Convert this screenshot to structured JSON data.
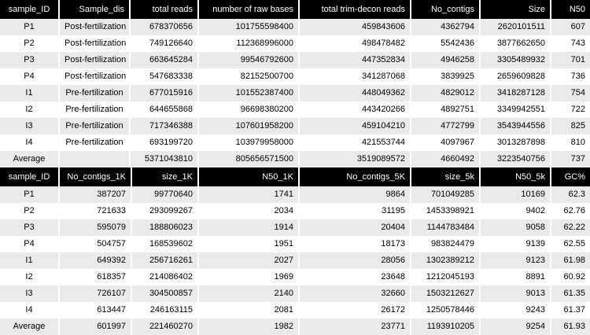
{
  "table1": {
    "headers": [
      "sample_ID",
      "Sample_dis",
      "total reads",
      "number of raw bases",
      "total trim-decon reads",
      "No_contigs",
      "Size",
      "N50"
    ],
    "rows": [
      [
        "P1",
        "Post-fertilization",
        "678370656",
        "101755598400",
        "459843606",
        "4362794",
        "2620101511",
        "607"
      ],
      [
        "P2",
        "Post-fertilization",
        "749126640",
        "112368996000",
        "498478482",
        "5542436",
        "3877662650",
        "743"
      ],
      [
        "P3",
        "Post-fertilization",
        "663645284",
        "99546792600",
        "447352834",
        "4946258",
        "3305489932",
        "701"
      ],
      [
        "P4",
        "Post-fertilization",
        "547683338",
        "82152500700",
        "341287068",
        "3839925",
        "2659609828",
        "736"
      ],
      [
        "I1",
        "Pre-fertilization",
        "677015916",
        "101552387400",
        "448049362",
        "4829012",
        "3418287128",
        "754"
      ],
      [
        "I2",
        "Pre-fertilization",
        "644655868",
        "96698380200",
        "443420266",
        "4892751",
        "3349942551",
        "722"
      ],
      [
        "I3",
        "Pre-fertilization",
        "717346388",
        "107601958200",
        "459104210",
        "4772799",
        "3543944556",
        "825"
      ],
      [
        "I4",
        "Pre-fertilization",
        "693199720",
        "103979958000",
        "421553744",
        "4097967",
        "3013287898",
        "810"
      ],
      [
        "Average",
        "",
        "5371043810",
        "805656571500",
        "3519089572",
        "4660492",
        "3223540756",
        "737"
      ]
    ]
  },
  "table2": {
    "headers": [
      "sample_ID",
      "No_contigs_1K",
      "size_1K",
      "N50_1K",
      "No_contigs_5K",
      "size_5k",
      "N50_5k",
      "GC%"
    ],
    "rows": [
      [
        "P1",
        "387207",
        "99770640",
        "1741",
        "9864",
        "701049285",
        "10169",
        "62.3"
      ],
      [
        "P2",
        "721633",
        "293099267",
        "2034",
        "31195",
        "1453398921",
        "9402",
        "62.76"
      ],
      [
        "P3",
        "595079",
        "188806023",
        "1914",
        "20404",
        "1144783484",
        "9058",
        "62.22"
      ],
      [
        "P4",
        "504757",
        "168539602",
        "1951",
        "18173",
        "983824479",
        "9139",
        "62.55"
      ],
      [
        "I1",
        "649392",
        "256716261",
        "2027",
        "28056",
        "1302389212",
        "9123",
        "61.98"
      ],
      [
        "I2",
        "618357",
        "214086402",
        "1969",
        "23648",
        "1212045193",
        "8891",
        "60.92"
      ],
      [
        "I3",
        "726107",
        "304500857",
        "2140",
        "32660",
        "1503212627",
        "9013",
        "61.35"
      ],
      [
        "I4",
        "613447",
        "246163115",
        "2081",
        "26172",
        "1250578446",
        "9243",
        "61.37"
      ],
      [
        "Average",
        "601997",
        "221460270",
        "1982",
        "23771",
        "1193910205",
        "9254",
        "61.93"
      ]
    ]
  }
}
